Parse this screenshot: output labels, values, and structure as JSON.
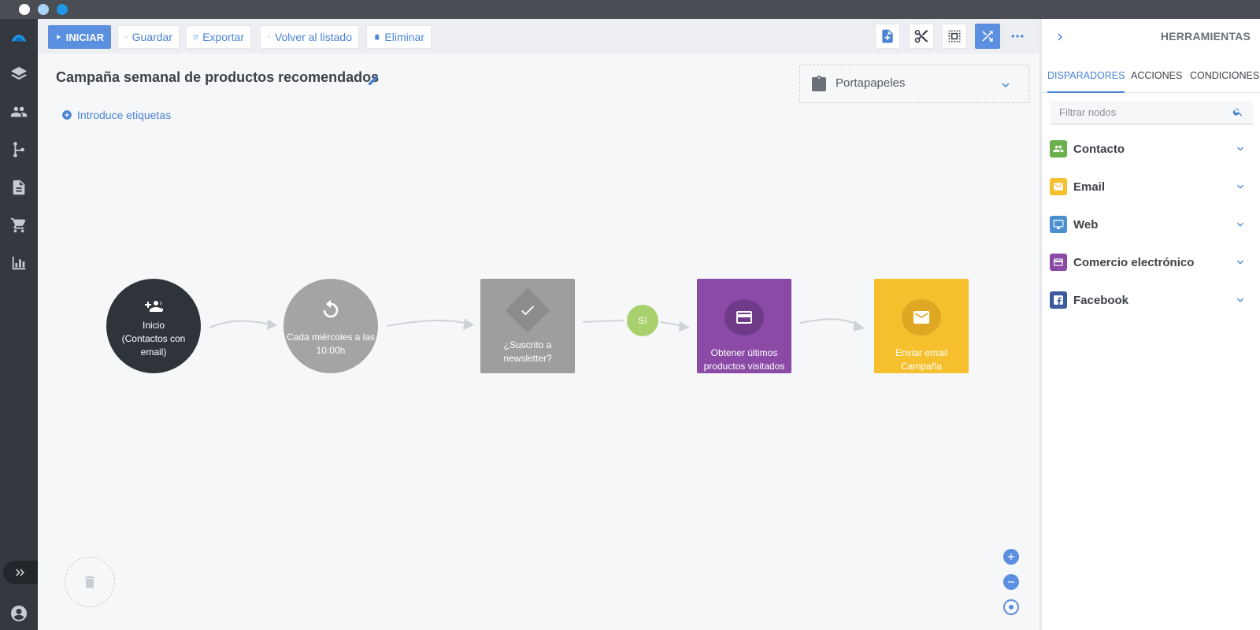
{
  "toolbar": {
    "start_label": "INICIAR",
    "save_label": "Guardar",
    "export_label": "Exportar",
    "back_label": "Volver al listado",
    "delete_label": "Eliminar"
  },
  "campaign": {
    "title": "Campaña semanal de productos recomendados",
    "tags_placeholder": "Introduce etiquetas"
  },
  "clipboard": {
    "label": "Portapapeles"
  },
  "flow": {
    "nodes": [
      {
        "id": "start",
        "lines": [
          "Inicio",
          "(Contactos con",
          "email)"
        ],
        "color": "#2f343b"
      },
      {
        "id": "schedule",
        "lines": [
          "Cada miércoles a las",
          "10:00h"
        ],
        "color": "#a3a4a6"
      },
      {
        "id": "condition",
        "lines": [
          "¿Suscrito a",
          "newsletter?"
        ],
        "color": "#9d9ea0"
      },
      {
        "id": "action",
        "lines": [
          "Obtener últimos",
          "productos visitados"
        ],
        "color": "#8a4aa6"
      },
      {
        "id": "email",
        "lines": [
          "Enviar email Campaña"
        ],
        "color": "#f6bf2e"
      }
    ],
    "yes_label": "Sí"
  },
  "panel": {
    "title": "HERRAMIENTAS",
    "tabs": [
      {
        "label": "DISPARADORES",
        "active": true
      },
      {
        "label": "ACCIONES",
        "active": false
      },
      {
        "label": "CONDICIONES",
        "active": false
      }
    ],
    "search_placeholder": "Filtrar nodos",
    "categories": [
      {
        "label": "Contacto",
        "color": "#6ab04c",
        "icon": "people-icon"
      },
      {
        "label": "Email",
        "color": "#f6bf2e",
        "icon": "envelope-icon"
      },
      {
        "label": "Web",
        "color": "#4a90d0",
        "icon": "monitor-icon"
      },
      {
        "label": "Comercio electrónico",
        "color": "#8a4aa6",
        "icon": "card-icon"
      },
      {
        "label": "Facebook",
        "color": "#3b5b9d",
        "icon": "facebook-icon"
      }
    ]
  },
  "colors": {
    "accent": "#5b8fdf",
    "link": "#4a83d4",
    "sidebar": "#34393f"
  }
}
